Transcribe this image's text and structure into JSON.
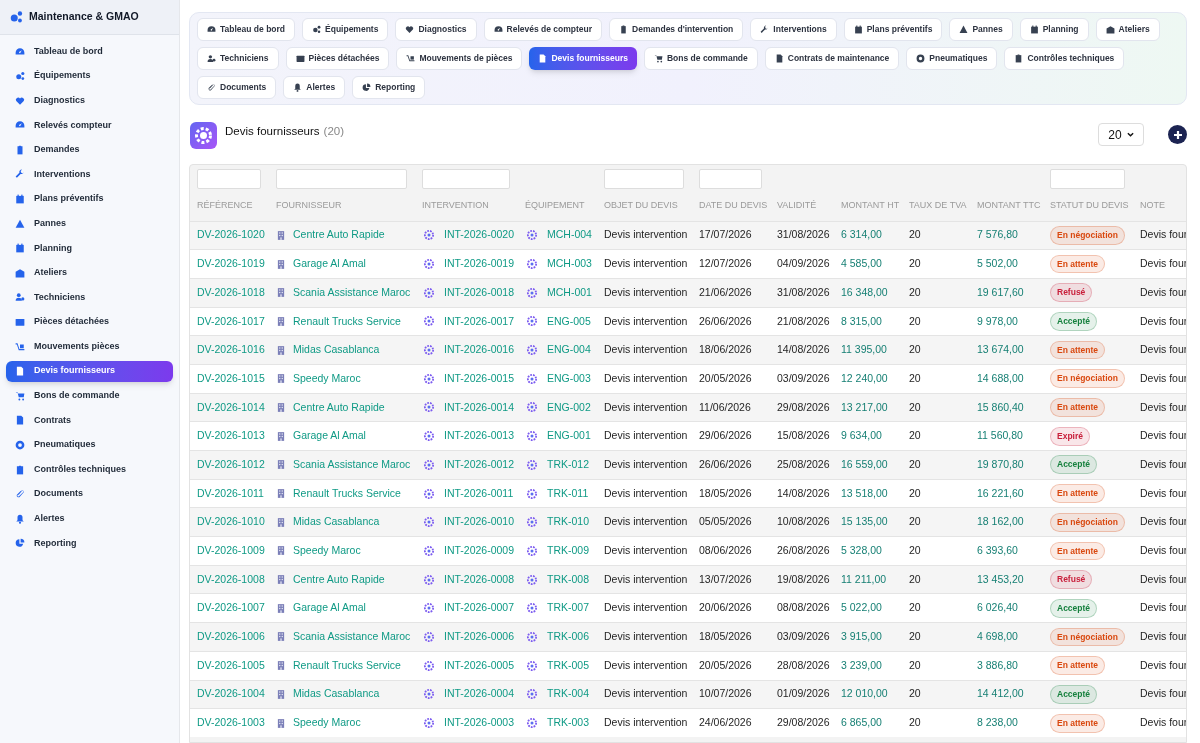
{
  "app": {
    "title": "Maintenance & GMAO"
  },
  "sidebar": {
    "items": [
      {
        "label": "Tableau de bord",
        "selected": false
      },
      {
        "label": "Équipements",
        "selected": false
      },
      {
        "label": "Diagnostics",
        "selected": false
      },
      {
        "label": "Relevés compteur",
        "selected": false
      },
      {
        "label": "Demandes",
        "selected": false
      },
      {
        "label": "Interventions",
        "selected": false
      },
      {
        "label": "Plans préventifs",
        "selected": false
      },
      {
        "label": "Pannes",
        "selected": false
      },
      {
        "label": "Planning",
        "selected": false
      },
      {
        "label": "Ateliers",
        "selected": false
      },
      {
        "label": "Techniciens",
        "selected": false
      },
      {
        "label": "Pièces détachées",
        "selected": false
      },
      {
        "label": "Mouvements pièces",
        "selected": false
      },
      {
        "label": "Devis fournisseurs",
        "selected": true
      },
      {
        "label": "Bons de commande",
        "selected": false
      },
      {
        "label": "Contrats",
        "selected": false
      },
      {
        "label": "Pneumatiques",
        "selected": false
      },
      {
        "label": "Contrôles techniques",
        "selected": false
      },
      {
        "label": "Documents",
        "selected": false
      },
      {
        "label": "Alertes",
        "selected": false
      },
      {
        "label": "Reporting",
        "selected": false
      }
    ]
  },
  "tabs": [
    {
      "label": "Tableau de bord",
      "selected": false
    },
    {
      "label": "Équipements",
      "selected": false
    },
    {
      "label": "Diagnostics",
      "selected": false
    },
    {
      "label": "Relevés de compteur",
      "selected": false
    },
    {
      "label": "Demandes d'intervention",
      "selected": false
    },
    {
      "label": "Interventions",
      "selected": false
    },
    {
      "label": "Plans préventifs",
      "selected": false
    },
    {
      "label": "Pannes",
      "selected": false
    },
    {
      "label": "Planning",
      "selected": false
    },
    {
      "label": "Ateliers",
      "selected": false
    },
    {
      "label": "Techniciens",
      "selected": false
    },
    {
      "label": "Pièces détachées",
      "selected": false
    },
    {
      "label": "Mouvements de pièces",
      "selected": false
    },
    {
      "label": "Devis fournisseurs",
      "selected": true
    },
    {
      "label": "Bons de commande",
      "selected": false
    },
    {
      "label": "Contrats de maintenance",
      "selected": false
    },
    {
      "label": "Pneumatiques",
      "selected": false
    },
    {
      "label": "Contrôles techniques",
      "selected": false
    },
    {
      "label": "Documents",
      "selected": false
    },
    {
      "label": "Alertes",
      "selected": false
    },
    {
      "label": "Reporting",
      "selected": false
    }
  ],
  "page": {
    "title": "Devis fournisseurs",
    "count": "(20)",
    "page_size": "20"
  },
  "table": {
    "columns": [
      {
        "label": "RÉFÉRENCE",
        "filter": true
      },
      {
        "label": "FOURNISSEUR",
        "filter": true
      },
      {
        "label": "INTERVENTION",
        "filter": true
      },
      {
        "label": "ÉQUIPEMENT",
        "filter": false
      },
      {
        "label": "OBJET DU DEVIS",
        "filter": true
      },
      {
        "label": "DATE DU DEVIS",
        "filter": true
      },
      {
        "label": "VALIDITÉ",
        "filter": false
      },
      {
        "label": "MONTANT HT",
        "filter": false
      },
      {
        "label": "TAUX DE TVA",
        "filter": false
      },
      {
        "label": "MONTANT TTC",
        "filter": false
      },
      {
        "label": "STATUT DU DEVIS",
        "filter": true
      },
      {
        "label": "NOTE",
        "filter": false
      }
    ],
    "rows": [
      {
        "reference": "DV-2026-1020",
        "supplier": "Centre Auto Rapide",
        "intervention": "INT-2026-0020",
        "equipment": "MCH-004",
        "subject": "Devis intervention",
        "date": "17/07/2026",
        "validity": "31/08/2026",
        "amount_ht": "6 314,00",
        "vat_rate": "20",
        "amount_ttc": "7 576,80",
        "status": {
          "label": "En négociation",
          "color": "#d9480f"
        },
        "note": "Devis four"
      },
      {
        "reference": "DV-2026-1019",
        "supplier": "Garage Al Amal",
        "intervention": "INT-2026-0019",
        "equipment": "MCH-003",
        "subject": "Devis intervention",
        "date": "12/07/2026",
        "validity": "04/09/2026",
        "amount_ht": "4 585,00",
        "vat_rate": "20",
        "amount_ttc": "5 502,00",
        "status": {
          "label": "En attente",
          "color": "#d9480f"
        },
        "note": "Devis four"
      },
      {
        "reference": "DV-2026-1018",
        "supplier": "Scania Assistance Maroc",
        "intervention": "INT-2026-0018",
        "equipment": "MCH-001",
        "subject": "Devis intervention",
        "date": "21/06/2026",
        "validity": "31/08/2026",
        "amount_ht": "16 348,00",
        "vat_rate": "20",
        "amount_ttc": "19 617,60",
        "status": {
          "label": "Refusé",
          "color": "#c81e3a"
        },
        "note": "Devis four"
      },
      {
        "reference": "DV-2026-1017",
        "supplier": "Renault Trucks Service",
        "intervention": "INT-2026-0017",
        "equipment": "ENG-005",
        "subject": "Devis intervention",
        "date": "26/06/2026",
        "validity": "21/08/2026",
        "amount_ht": "8 315,00",
        "vat_rate": "20",
        "amount_ttc": "9 978,00",
        "status": {
          "label": "Accepté",
          "color": "#15803d"
        },
        "note": "Devis four"
      },
      {
        "reference": "DV-2026-1016",
        "supplier": "Midas Casablanca",
        "intervention": "INT-2026-0016",
        "equipment": "ENG-004",
        "subject": "Devis intervention",
        "date": "18/06/2026",
        "validity": "14/08/2026",
        "amount_ht": "11 395,00",
        "vat_rate": "20",
        "amount_ttc": "13 674,00",
        "status": {
          "label": "En attente",
          "color": "#d9480f"
        },
        "note": "Devis four"
      },
      {
        "reference": "DV-2026-1015",
        "supplier": "Speedy Maroc",
        "intervention": "INT-2026-0015",
        "equipment": "ENG-003",
        "subject": "Devis intervention",
        "date": "20/05/2026",
        "validity": "03/09/2026",
        "amount_ht": "12 240,00",
        "vat_rate": "20",
        "amount_ttc": "14 688,00",
        "status": {
          "label": "En négociation",
          "color": "#d9480f"
        },
        "note": "Devis four"
      },
      {
        "reference": "DV-2026-1014",
        "supplier": "Centre Auto Rapide",
        "intervention": "INT-2026-0014",
        "equipment": "ENG-002",
        "subject": "Devis intervention",
        "date": "11/06/2026",
        "validity": "29/08/2026",
        "amount_ht": "13 217,00",
        "vat_rate": "20",
        "amount_ttc": "15 860,40",
        "status": {
          "label": "En attente",
          "color": "#d9480f"
        },
        "note": "Devis four"
      },
      {
        "reference": "DV-2026-1013",
        "supplier": "Garage Al Amal",
        "intervention": "INT-2026-0013",
        "equipment": "ENG-001",
        "subject": "Devis intervention",
        "date": "29/06/2026",
        "validity": "15/08/2026",
        "amount_ht": "9 634,00",
        "vat_rate": "20",
        "amount_ttc": "11 560,80",
        "status": {
          "label": "Expiré",
          "color": "#c81e3a"
        },
        "note": "Devis four"
      },
      {
        "reference": "DV-2026-1012",
        "supplier": "Scania Assistance Maroc",
        "intervention": "INT-2026-0012",
        "equipment": "TRK-012",
        "subject": "Devis intervention",
        "date": "26/06/2026",
        "validity": "25/08/2026",
        "amount_ht": "16 559,00",
        "vat_rate": "20",
        "amount_ttc": "19 870,80",
        "status": {
          "label": "Accepté",
          "color": "#15803d"
        },
        "note": "Devis four"
      },
      {
        "reference": "DV-2026-1011",
        "supplier": "Renault Trucks Service",
        "intervention": "INT-2026-0011",
        "equipment": "TRK-011",
        "subject": "Devis intervention",
        "date": "18/05/2026",
        "validity": "14/08/2026",
        "amount_ht": "13 518,00",
        "vat_rate": "20",
        "amount_ttc": "16 221,60",
        "status": {
          "label": "En attente",
          "color": "#d9480f"
        },
        "note": "Devis four"
      },
      {
        "reference": "DV-2026-1010",
        "supplier": "Midas Casablanca",
        "intervention": "INT-2026-0010",
        "equipment": "TRK-010",
        "subject": "Devis intervention",
        "date": "05/05/2026",
        "validity": "10/08/2026",
        "amount_ht": "15 135,00",
        "vat_rate": "20",
        "amount_ttc": "18 162,00",
        "status": {
          "label": "En négociation",
          "color": "#d9480f"
        },
        "note": "Devis four"
      },
      {
        "reference": "DV-2026-1009",
        "supplier": "Speedy Maroc",
        "intervention": "INT-2026-0009",
        "equipment": "TRK-009",
        "subject": "Devis intervention",
        "date": "08/06/2026",
        "validity": "26/08/2026",
        "amount_ht": "5 328,00",
        "vat_rate": "20",
        "amount_ttc": "6 393,60",
        "status": {
          "label": "En attente",
          "color": "#d9480f"
        },
        "note": "Devis four"
      },
      {
        "reference": "DV-2026-1008",
        "supplier": "Centre Auto Rapide",
        "intervention": "INT-2026-0008",
        "equipment": "TRK-008",
        "subject": "Devis intervention",
        "date": "13/07/2026",
        "validity": "19/08/2026",
        "amount_ht": "11 211,00",
        "vat_rate": "20",
        "amount_ttc": "13 453,20",
        "status": {
          "label": "Refusé",
          "color": "#c81e3a"
        },
        "note": "Devis four"
      },
      {
        "reference": "DV-2026-1007",
        "supplier": "Garage Al Amal",
        "intervention": "INT-2026-0007",
        "equipment": "TRK-007",
        "subject": "Devis intervention",
        "date": "20/06/2026",
        "validity": "08/08/2026",
        "amount_ht": "5 022,00",
        "vat_rate": "20",
        "amount_ttc": "6 026,40",
        "status": {
          "label": "Accepté",
          "color": "#15803d"
        },
        "note": "Devis four"
      },
      {
        "reference": "DV-2026-1006",
        "supplier": "Scania Assistance Maroc",
        "intervention": "INT-2026-0006",
        "equipment": "TRK-006",
        "subject": "Devis intervention",
        "date": "18/05/2026",
        "validity": "03/09/2026",
        "amount_ht": "3 915,00",
        "vat_rate": "20",
        "amount_ttc": "4 698,00",
        "status": {
          "label": "En négociation",
          "color": "#d9480f"
        },
        "note": "Devis four"
      },
      {
        "reference": "DV-2026-1005",
        "supplier": "Renault Trucks Service",
        "intervention": "INT-2026-0005",
        "equipment": "TRK-005",
        "subject": "Devis intervention",
        "date": "20/05/2026",
        "validity": "28/08/2026",
        "amount_ht": "3 239,00",
        "vat_rate": "20",
        "amount_ttc": "3 886,80",
        "status": {
          "label": "En attente",
          "color": "#d9480f"
        },
        "note": "Devis four"
      },
      {
        "reference": "DV-2026-1004",
        "supplier": "Midas Casablanca",
        "intervention": "INT-2026-0004",
        "equipment": "TRK-004",
        "subject": "Devis intervention",
        "date": "10/07/2026",
        "validity": "01/09/2026",
        "amount_ht": "12 010,00",
        "vat_rate": "20",
        "amount_ttc": "14 412,00",
        "status": {
          "label": "Accepté",
          "color": "#15803d"
        },
        "note": "Devis four"
      },
      {
        "reference": "DV-2026-1003",
        "supplier": "Speedy Maroc",
        "intervention": "INT-2026-0003",
        "equipment": "TRK-003",
        "subject": "Devis intervention",
        "date": "24/06/2026",
        "validity": "29/08/2026",
        "amount_ht": "6 865,00",
        "vat_rate": "20",
        "amount_ttc": "8 238,00",
        "status": {
          "label": "En attente",
          "color": "#d9480f"
        },
        "note": "Devis four"
      }
    ]
  }
}
